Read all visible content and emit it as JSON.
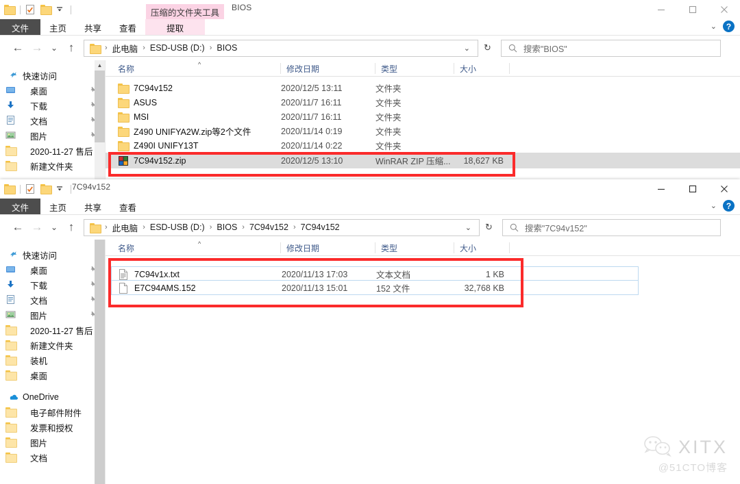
{
  "colors": {
    "annotation_red": "#fb2b2b",
    "file_tab": "#4d4d4d",
    "contextual_tab": "#fbd3e4",
    "contextual_tab_active": "#fde3ee",
    "help_blue": "#0a72c4",
    "column_header_text": "#3f5a8a",
    "selected_row": "#dcdcdc"
  },
  "window1": {
    "title": "BIOS",
    "quick_access": [
      "folder-icon",
      "properties-icon",
      "new-folder-icon",
      "customize-dropdown-icon"
    ],
    "window_buttons": {
      "minimize": "minimize-icon",
      "maximize": "maximize-icon",
      "close": "close-icon"
    },
    "contextual_group_label": "压缩的文件夹工具",
    "tabs": [
      {
        "label": "文件",
        "type": "file"
      },
      {
        "label": "主页",
        "type": "normal"
      },
      {
        "label": "共享",
        "type": "normal"
      },
      {
        "label": "查看",
        "type": "normal"
      },
      {
        "label": "提取",
        "type": "contextual"
      }
    ],
    "ribbon_right": {
      "expand": "chevron-down-icon",
      "help": "?"
    },
    "nav": {
      "back": "back-arrow-icon",
      "forward": "forward-arrow-icon",
      "recent": "chevron-down-icon",
      "up": "up-arrow-icon",
      "breadcrumbs": [
        "此电脑",
        "ESD-USB (D:)",
        "BIOS"
      ],
      "history_chevron": "chevron-down-icon",
      "refresh": "refresh-icon"
    },
    "search": {
      "placeholder": "搜索\"BIOS\"",
      "icon": "search-icon"
    },
    "sidebar": [
      {
        "label": "快速访问",
        "icon": "pin-star-icon",
        "root": true,
        "pinned": false
      },
      {
        "label": "桌面",
        "icon": "desktop-icon",
        "root": false,
        "pinned": true
      },
      {
        "label": "下载",
        "icon": "download-icon",
        "root": false,
        "pinned": true
      },
      {
        "label": "文档",
        "icon": "document-icon",
        "root": false,
        "pinned": true
      },
      {
        "label": "图片",
        "icon": "picture-icon",
        "root": false,
        "pinned": true
      },
      {
        "label": "2020-11-27 售后",
        "icon": "folder-icon",
        "root": false,
        "pinned": false
      },
      {
        "label": "新建文件夹",
        "icon": "folder-icon",
        "root": false,
        "pinned": false
      }
    ],
    "columns": [
      {
        "label": "名称",
        "key": "name"
      },
      {
        "label": "修改日期",
        "key": "date"
      },
      {
        "label": "类型",
        "key": "type"
      },
      {
        "label": "大小",
        "key": "size"
      }
    ],
    "sort_column": "名称",
    "sort_direction": "asc",
    "rows": [
      {
        "name": "7C94v152",
        "date": "2020/12/5 13:11",
        "type": "文件夹",
        "size": "",
        "icon": "folder-icon",
        "selected": false
      },
      {
        "name": "ASUS",
        "date": "2020/11/7 16:11",
        "type": "文件夹",
        "size": "",
        "icon": "folder-icon",
        "selected": false
      },
      {
        "name": "MSI",
        "date": "2020/11/7 16:11",
        "type": "文件夹",
        "size": "",
        "icon": "folder-icon",
        "selected": false
      },
      {
        "name": "Z490 UNIFYA2W.zip等2个文件",
        "date": "2020/11/14 0:19",
        "type": "文件夹",
        "size": "",
        "icon": "folder-icon",
        "selected": false
      },
      {
        "name": "Z490I UNIFY13T",
        "date": "2020/11/14 0:22",
        "type": "文件夹",
        "size": "",
        "icon": "folder-icon",
        "selected": false
      },
      {
        "name": "7C94v152.zip",
        "date": "2020/12/5 13:10",
        "type": "WinRAR ZIP 压缩...",
        "size": "18,627 KB",
        "icon": "winrar-zip-icon",
        "selected": true
      }
    ]
  },
  "window2": {
    "title": "7C94v152",
    "quick_access": [
      "folder-icon",
      "properties-icon",
      "new-folder-icon",
      "customize-dropdown-icon"
    ],
    "window_buttons": {
      "minimize": "minimize-icon",
      "maximize": "maximize-icon",
      "close": "close-icon"
    },
    "tabs": [
      {
        "label": "文件",
        "type": "file"
      },
      {
        "label": "主页",
        "type": "normal"
      },
      {
        "label": "共享",
        "type": "normal"
      },
      {
        "label": "查看",
        "type": "normal"
      }
    ],
    "ribbon_right": {
      "expand": "chevron-down-icon",
      "help": "?"
    },
    "nav": {
      "back": "back-arrow-icon",
      "forward": "forward-arrow-icon",
      "recent": "chevron-down-icon",
      "up": "up-arrow-icon",
      "breadcrumbs": [
        "此电脑",
        "ESD-USB (D:)",
        "BIOS",
        "7C94v152",
        "7C94v152"
      ],
      "history_chevron": "chevron-down-icon",
      "refresh": "refresh-icon"
    },
    "search": {
      "placeholder": "搜索\"7C94v152\"",
      "icon": "search-icon"
    },
    "sidebar": [
      {
        "label": "快速访问",
        "icon": "pin-star-icon",
        "root": true,
        "pinned": false
      },
      {
        "label": "桌面",
        "icon": "desktop-icon",
        "root": false,
        "pinned": true
      },
      {
        "label": "下载",
        "icon": "download-icon",
        "root": false,
        "pinned": true
      },
      {
        "label": "文档",
        "icon": "document-icon",
        "root": false,
        "pinned": true
      },
      {
        "label": "图片",
        "icon": "picture-icon",
        "root": false,
        "pinned": true
      },
      {
        "label": "2020-11-27 售后",
        "icon": "folder-icon",
        "root": false,
        "pinned": false
      },
      {
        "label": "新建文件夹",
        "icon": "folder-icon",
        "root": false,
        "pinned": false
      },
      {
        "label": "装机",
        "icon": "folder-icon",
        "root": false,
        "pinned": false
      },
      {
        "label": "桌面",
        "icon": "folder-icon",
        "root": false,
        "pinned": false
      },
      {
        "label": "OneDrive",
        "icon": "onedrive-icon",
        "root": true,
        "pinned": false
      },
      {
        "label": "电子邮件附件",
        "icon": "folder-icon",
        "root": false,
        "pinned": false
      },
      {
        "label": "发票和授权",
        "icon": "folder-icon",
        "root": false,
        "pinned": false
      },
      {
        "label": "图片",
        "icon": "folder-icon",
        "root": false,
        "pinned": false
      },
      {
        "label": "文档",
        "icon": "folder-icon",
        "root": false,
        "pinned": false
      }
    ],
    "columns": [
      {
        "label": "名称",
        "key": "name"
      },
      {
        "label": "修改日期",
        "key": "date"
      },
      {
        "label": "类型",
        "key": "type"
      },
      {
        "label": "大小",
        "key": "size"
      }
    ],
    "sort_column": "名称",
    "sort_direction": "asc",
    "rows": [
      {
        "name": "7C94v1x.txt",
        "date": "2020/11/13 17:03",
        "type": "文本文档",
        "size": "1 KB",
        "icon": "text-file-icon",
        "selected": true
      },
      {
        "name": "E7C94AMS.152",
        "date": "2020/11/13 15:01",
        "type": "152 文件",
        "size": "32,768 KB",
        "icon": "generic-file-icon",
        "selected": true
      }
    ]
  },
  "watermark": {
    "name": "XITX",
    "sub": "@51CTO博客",
    "icon": "wechat-icon"
  }
}
